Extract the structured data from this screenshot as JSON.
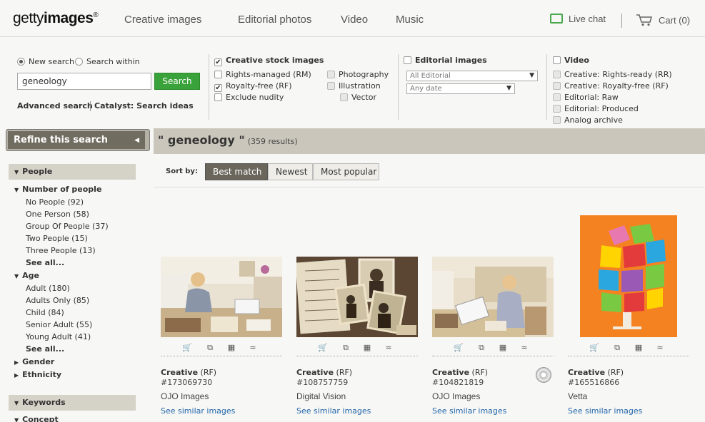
{
  "header": {
    "logo_light": "getty",
    "logo_bold": "images",
    "logo_mark": "®",
    "nav": [
      "Creative images",
      "Editorial photos",
      "Video",
      "Music"
    ],
    "live_chat": "Live chat",
    "cart": "Cart (0)"
  },
  "search": {
    "radio_new": "New search",
    "radio_within": "Search within",
    "query": "geneology",
    "button": "Search",
    "advanced": "Advanced search",
    "catalyst": "Catalyst: Search ideas"
  },
  "filters": {
    "creative": {
      "title": "Creative stock images",
      "rights_managed": "Rights-managed (RM)",
      "royalty_free": "Royalty-free (RF)",
      "exclude_nudity": "Exclude nudity",
      "photography": "Photography",
      "illustration": "Illustration",
      "vector": "Vector"
    },
    "editorial": {
      "title": "Editorial images",
      "select1": "All Editorial",
      "select2": "Any date"
    },
    "video": {
      "title": "Video",
      "items": [
        "Creative: Rights-ready (RR)",
        "Creative: Royalty-free (RF)",
        "Editorial: Raw",
        "Editorial: Produced",
        "Analog archive"
      ]
    }
  },
  "sidebar": {
    "refine": "Refine this search",
    "people": "People",
    "number_of_people": "Number of people",
    "number_items": [
      "No People (92)",
      "One Person (58)",
      "Group Of People (37)",
      "Two People (15)",
      "Three People (13)"
    ],
    "see_all_1": "See all...",
    "age": "Age",
    "age_items": [
      "Adult (180)",
      "Adults Only (85)",
      "Child (84)",
      "Senior Adult (55)",
      "Young Adult (41)"
    ],
    "see_all_2": "See all...",
    "gender": "Gender",
    "ethnicity": "Ethnicity",
    "keywords": "Keywords",
    "concept": "Concept"
  },
  "results": {
    "query_display": "\" geneology \"",
    "count": "(359 results)",
    "sort_label": "Sort by:",
    "sort_options": [
      "Best match",
      "Newest",
      "Most popular"
    ],
    "items": [
      {
        "type": "Creative",
        "license": "(RF)",
        "id": "#173069730",
        "provider": "OJO Images",
        "link": "See similar images"
      },
      {
        "type": "Creative",
        "license": "(RF)",
        "id": "#108757759",
        "provider": "Digital Vision",
        "link": "See similar images"
      },
      {
        "type": "Creative",
        "license": "(RF)",
        "id": "#104821819",
        "provider": "OJO Images",
        "link": "See similar images"
      },
      {
        "type": "Creative",
        "license": "(RF)",
        "id": "#165516866",
        "provider": "Vetta",
        "link": "See similar images"
      }
    ]
  },
  "colors": {
    "search_green": "#3aa23a",
    "sidebar_header": "#716c60",
    "result_bar": "#cac6bb",
    "link_blue": "#2266aa",
    "sort_active": "#6a665c"
  }
}
